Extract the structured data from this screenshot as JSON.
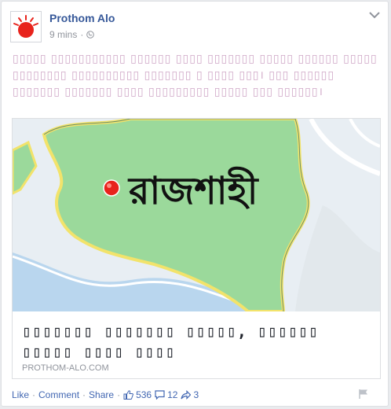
{
  "post": {
    "page_name": "Prothom Alo",
    "time": "9 mins",
    "dot": "·",
    "text": "▯▯▯▯▯ ▯▯▯▯▯▯▯▯▯▯▯ ▯▯▯▯▯▯ ▯▯▯▯ ▯▯▯▯▯▯▯ ▯▯▯▯▯ ▯▯▯▯▯▯ ▯▯▯▯▯ ▯▯▯▯▯▯▯▯ ▯▯▯▯▯▯▯▯▯▯ ▯▯▯▯▯▯▯ ▯ ▯▯▯▯ ▯▯▯। ▯▯▯ ▯▯▯▯▯▯ ▯▯▯▯▯▯▯ ▯▯▯▯▯▯▯ ▯▯▯▯ ▯▯▯▯▯▯▯▯▯ ▯▯▯▯▯ ▯▯▯ ▯▯▯▯▯▯।"
  },
  "link": {
    "map_label": "রাজশাহী",
    "title": "▯▯▯▯▯▯▯ ▯▯▯▯▯▯▯ ▯▯▯▯▯, ▯▯▯▯▯▯ ▯▯▯▯▯ ▯▯▯▯ ▯▯▯▯",
    "domain": "PROTHOM-ALO.COM"
  },
  "actions": {
    "like": "Like",
    "comment": "Comment",
    "share": "Share",
    "sep": "·",
    "likes_count": "536",
    "comments_count": "12",
    "shares_count": "3"
  },
  "colors": {
    "brand_red": "#e8231c",
    "link_blue": "#365899",
    "map_green": "#9bd99b",
    "river_blue": "#b9d6ee"
  },
  "icons": {
    "globe": "globe-icon",
    "chevron": "chevron-down-icon",
    "thumbs_up": "thumbs-up-icon",
    "comment": "comment-icon",
    "share": "share-arrow-icon",
    "flag": "flag-icon"
  }
}
